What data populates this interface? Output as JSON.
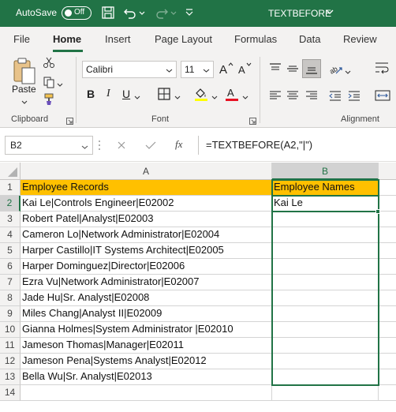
{
  "titlebar": {
    "autosave_label": "AutoSave",
    "autosave_state": "Off",
    "document_title": "TEXTBEFORE"
  },
  "ribbon_tabs": [
    "File",
    "Home",
    "Insert",
    "Page Layout",
    "Formulas",
    "Data",
    "Review"
  ],
  "active_tab": "Home",
  "ribbon": {
    "clipboard": {
      "paste_label": "Paste",
      "group_label": "Clipboard"
    },
    "font": {
      "font_name": "Calibri",
      "font_size": "11",
      "group_label": "Font"
    },
    "alignment": {
      "group_label": "Alignment"
    }
  },
  "formula_bar": {
    "name_box": "B2",
    "fx_label": "fx",
    "formula": "=TEXTBEFORE(A2,\"|\")"
  },
  "sheet": {
    "columns": [
      "A",
      "B"
    ],
    "selected_column": "B",
    "rows": [
      "1",
      "2",
      "3",
      "4",
      "5",
      "6",
      "7",
      "8",
      "9",
      "10",
      "11",
      "12",
      "13",
      "14"
    ],
    "selected_row": "2",
    "col_a": [
      "Employee Records",
      "Kai Le|Controls Engineer|E02002",
      "Robert Patel|Analyst|E02003",
      "Cameron Lo|Network Administrator|E02004",
      "Harper Castillo|IT Systems Architect|E02005",
      "Harper Dominguez|Director|E02006",
      "Ezra Vu|Network Administrator|E02007",
      "Jade Hu|Sr. Analyst|E02008",
      "Miles Chang|Analyst II|E02009",
      "Gianna Holmes|System Administrator |E02010",
      "Jameson Thomas|Manager|E02011",
      "Jameson Pena|Systems Analyst|E02012",
      "Bella Wu|Sr. Analyst|E02013",
      ""
    ],
    "col_b": [
      "Employee Names",
      "Kai Le",
      "",
      "",
      "",
      "",
      "",
      "",
      "",
      "",
      "",
      "",
      "",
      ""
    ],
    "header_fill": "#ffc000",
    "accent": "#217346"
  }
}
